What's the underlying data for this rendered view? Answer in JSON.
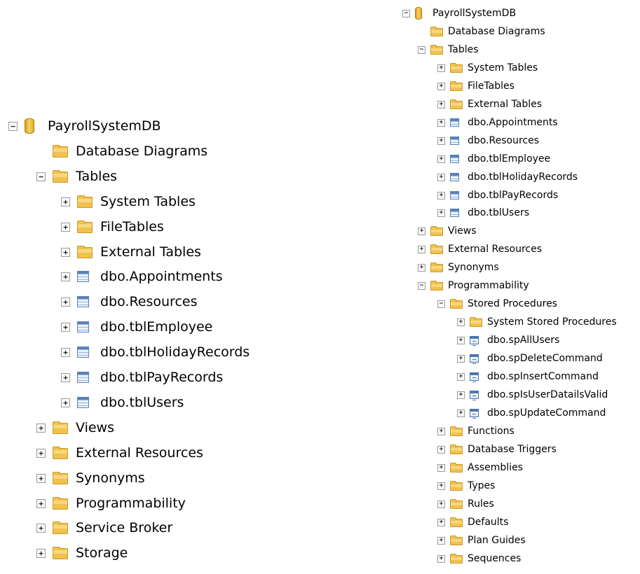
{
  "left_tree": {
    "nodes": [
      {
        "label": "PayrollSystemDB",
        "icon": "database-icon",
        "expander": "minus",
        "level": 0
      },
      {
        "label": "Database Diagrams",
        "icon": "folder-icon",
        "expander": "none",
        "level": 1
      },
      {
        "label": "Tables",
        "icon": "folder-icon",
        "expander": "minus",
        "level": 1
      },
      {
        "label": "System Tables",
        "icon": "folder-icon",
        "expander": "plus",
        "level": 2
      },
      {
        "label": "FileTables",
        "icon": "folder-icon",
        "expander": "plus",
        "level": 2
      },
      {
        "label": "External Tables",
        "icon": "folder-icon",
        "expander": "plus",
        "level": 2
      },
      {
        "label": "dbo.Appointments",
        "icon": "table-icon",
        "expander": "plus",
        "level": 2
      },
      {
        "label": "dbo.Resources",
        "icon": "table-icon",
        "expander": "plus",
        "level": 2
      },
      {
        "label": "dbo.tblEmployee",
        "icon": "table-icon",
        "expander": "plus",
        "level": 2
      },
      {
        "label": "dbo.tblHolidayRecords",
        "icon": "table-icon",
        "expander": "plus",
        "level": 2
      },
      {
        "label": "dbo.tblPayRecords",
        "icon": "table-icon",
        "expander": "plus",
        "level": 2
      },
      {
        "label": "dbo.tblUsers",
        "icon": "table-icon",
        "expander": "plus",
        "level": 2
      },
      {
        "label": "Views",
        "icon": "folder-icon",
        "expander": "plus",
        "level": 1
      },
      {
        "label": "External Resources",
        "icon": "folder-icon",
        "expander": "plus",
        "level": 1
      },
      {
        "label": "Synonyms",
        "icon": "folder-icon",
        "expander": "plus",
        "level": 1
      },
      {
        "label": "Programmability",
        "icon": "folder-icon",
        "expander": "plus",
        "level": 1
      },
      {
        "label": "Service Broker",
        "icon": "folder-icon",
        "expander": "plus",
        "level": 1
      },
      {
        "label": "Storage",
        "icon": "folder-icon",
        "expander": "plus",
        "level": 1
      }
    ]
  },
  "right_tree": {
    "nodes": [
      {
        "label": "PayrollSystemDB",
        "icon": "database-icon",
        "expander": "minus",
        "level": 0
      },
      {
        "label": "Database Diagrams",
        "icon": "folder-icon",
        "expander": "none",
        "level": 1
      },
      {
        "label": "Tables",
        "icon": "folder-icon",
        "expander": "minus",
        "level": 1
      },
      {
        "label": "System Tables",
        "icon": "folder-icon",
        "expander": "plus",
        "level": 2
      },
      {
        "label": "FileTables",
        "icon": "folder-icon",
        "expander": "plus",
        "level": 2
      },
      {
        "label": "External Tables",
        "icon": "folder-icon",
        "expander": "plus",
        "level": 2
      },
      {
        "label": "dbo.Appointments",
        "icon": "table-icon",
        "expander": "plus",
        "level": 2
      },
      {
        "label": "dbo.Resources",
        "icon": "table-icon",
        "expander": "plus",
        "level": 2
      },
      {
        "label": "dbo.tblEmployee",
        "icon": "table-icon",
        "expander": "plus",
        "level": 2
      },
      {
        "label": "dbo.tblHolidayRecords",
        "icon": "table-icon",
        "expander": "plus",
        "level": 2
      },
      {
        "label": "dbo.tblPayRecords",
        "icon": "table-icon",
        "expander": "plus",
        "level": 2
      },
      {
        "label": "dbo.tblUsers",
        "icon": "table-icon",
        "expander": "plus",
        "level": 2
      },
      {
        "label": "Views",
        "icon": "folder-icon",
        "expander": "plus",
        "level": 1
      },
      {
        "label": "External Resources",
        "icon": "folder-icon",
        "expander": "plus",
        "level": 1
      },
      {
        "label": "Synonyms",
        "icon": "folder-icon",
        "expander": "plus",
        "level": 1
      },
      {
        "label": "Programmability",
        "icon": "folder-icon",
        "expander": "minus",
        "level": 1
      },
      {
        "label": "Stored Procedures",
        "icon": "folder-icon",
        "expander": "minus",
        "level": 2
      },
      {
        "label": "System Stored Procedures",
        "icon": "folder-icon",
        "expander": "plus",
        "level": 3
      },
      {
        "label": "dbo.spAllUsers",
        "icon": "stored-procedure-icon",
        "expander": "plus",
        "level": 3
      },
      {
        "label": "dbo.spDeleteCommand",
        "icon": "stored-procedure-icon",
        "expander": "plus",
        "level": 3
      },
      {
        "label": "dbo.spInsertCommand",
        "icon": "stored-procedure-icon",
        "expander": "plus",
        "level": 3
      },
      {
        "label": "dbo.spIsUserDatailsValid",
        "icon": "stored-procedure-icon",
        "expander": "plus",
        "level": 3
      },
      {
        "label": "dbo.spUpdateCommand",
        "icon": "stored-procedure-icon",
        "expander": "plus",
        "level": 3
      },
      {
        "label": "Functions",
        "icon": "folder-icon",
        "expander": "plus",
        "level": 2
      },
      {
        "label": "Database Triggers",
        "icon": "folder-icon",
        "expander": "plus",
        "level": 2
      },
      {
        "label": "Assemblies",
        "icon": "folder-icon",
        "expander": "plus",
        "level": 2
      },
      {
        "label": "Types",
        "icon": "folder-icon",
        "expander": "plus",
        "level": 2
      },
      {
        "label": "Rules",
        "icon": "folder-icon",
        "expander": "plus",
        "level": 2
      },
      {
        "label": "Defaults",
        "icon": "folder-icon",
        "expander": "plus",
        "level": 2
      },
      {
        "label": "Plan Guides",
        "icon": "folder-icon",
        "expander": "plus",
        "level": 2
      },
      {
        "label": "Sequences",
        "icon": "folder-icon",
        "expander": "plus",
        "level": 2
      }
    ]
  }
}
